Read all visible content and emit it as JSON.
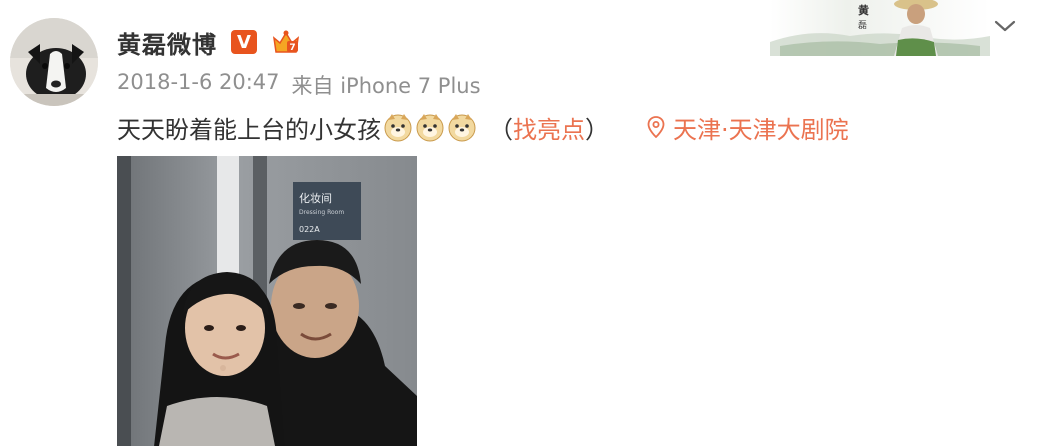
{
  "post": {
    "username": "黄磊微博",
    "verified_badge": "V",
    "timestamp": "2018-1-6 20:47",
    "source": "来自 iPhone 7 Plus",
    "text": "天天盼着能上台的小女孩",
    "emoji_count": 3,
    "highlight_open": "（",
    "highlight_link": "找亮点",
    "highlight_close": "）",
    "location": "天津·天津大剧院"
  },
  "banner": {
    "name_char_1": "黄",
    "name_char_2": "磊"
  },
  "photo": {
    "sign_title": "化妆间",
    "sign_subtitle": "Dressing Room",
    "sign_number": "022A"
  },
  "icons": {
    "verified": "verified-v-icon",
    "crown": "member-crown-icon",
    "emoji": "doge-emoji-icon",
    "location": "location-pin-icon",
    "menu": "chevron-down-icon"
  },
  "colors": {
    "accent": "#eb7350",
    "verified": "#e8541e",
    "text": "#333333",
    "meta": "#8f8f8f"
  }
}
